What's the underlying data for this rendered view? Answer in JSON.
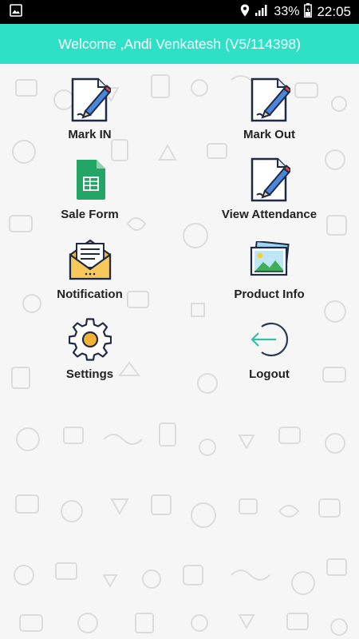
{
  "status_bar": {
    "battery_percent": "33%",
    "time": "22:05",
    "icons": [
      "image-icon",
      "location-icon",
      "signal-icon",
      "battery-icon"
    ]
  },
  "app_bar": {
    "title": "Welcome ,Andi Venkatesh (V5/114398)"
  },
  "colors": {
    "app_bar": "#2ee0c6",
    "status_bar": "#000000",
    "label_text": "#222222"
  },
  "menu": {
    "items": [
      {
        "label": "Mark IN",
        "icon": "pencil-document-icon"
      },
      {
        "label": "Mark Out",
        "icon": "pencil-document-icon"
      },
      {
        "label": "Sale Form",
        "icon": "google-sheets-icon"
      },
      {
        "label": "View Attendance",
        "icon": "pencil-document-icon"
      },
      {
        "label": "Notification",
        "icon": "envelope-letter-icon"
      },
      {
        "label": "Product Info",
        "icon": "picture-icon"
      },
      {
        "label": "Settings",
        "icon": "gear-icon"
      },
      {
        "label": "Logout",
        "icon": "logout-arrow-icon"
      }
    ]
  }
}
